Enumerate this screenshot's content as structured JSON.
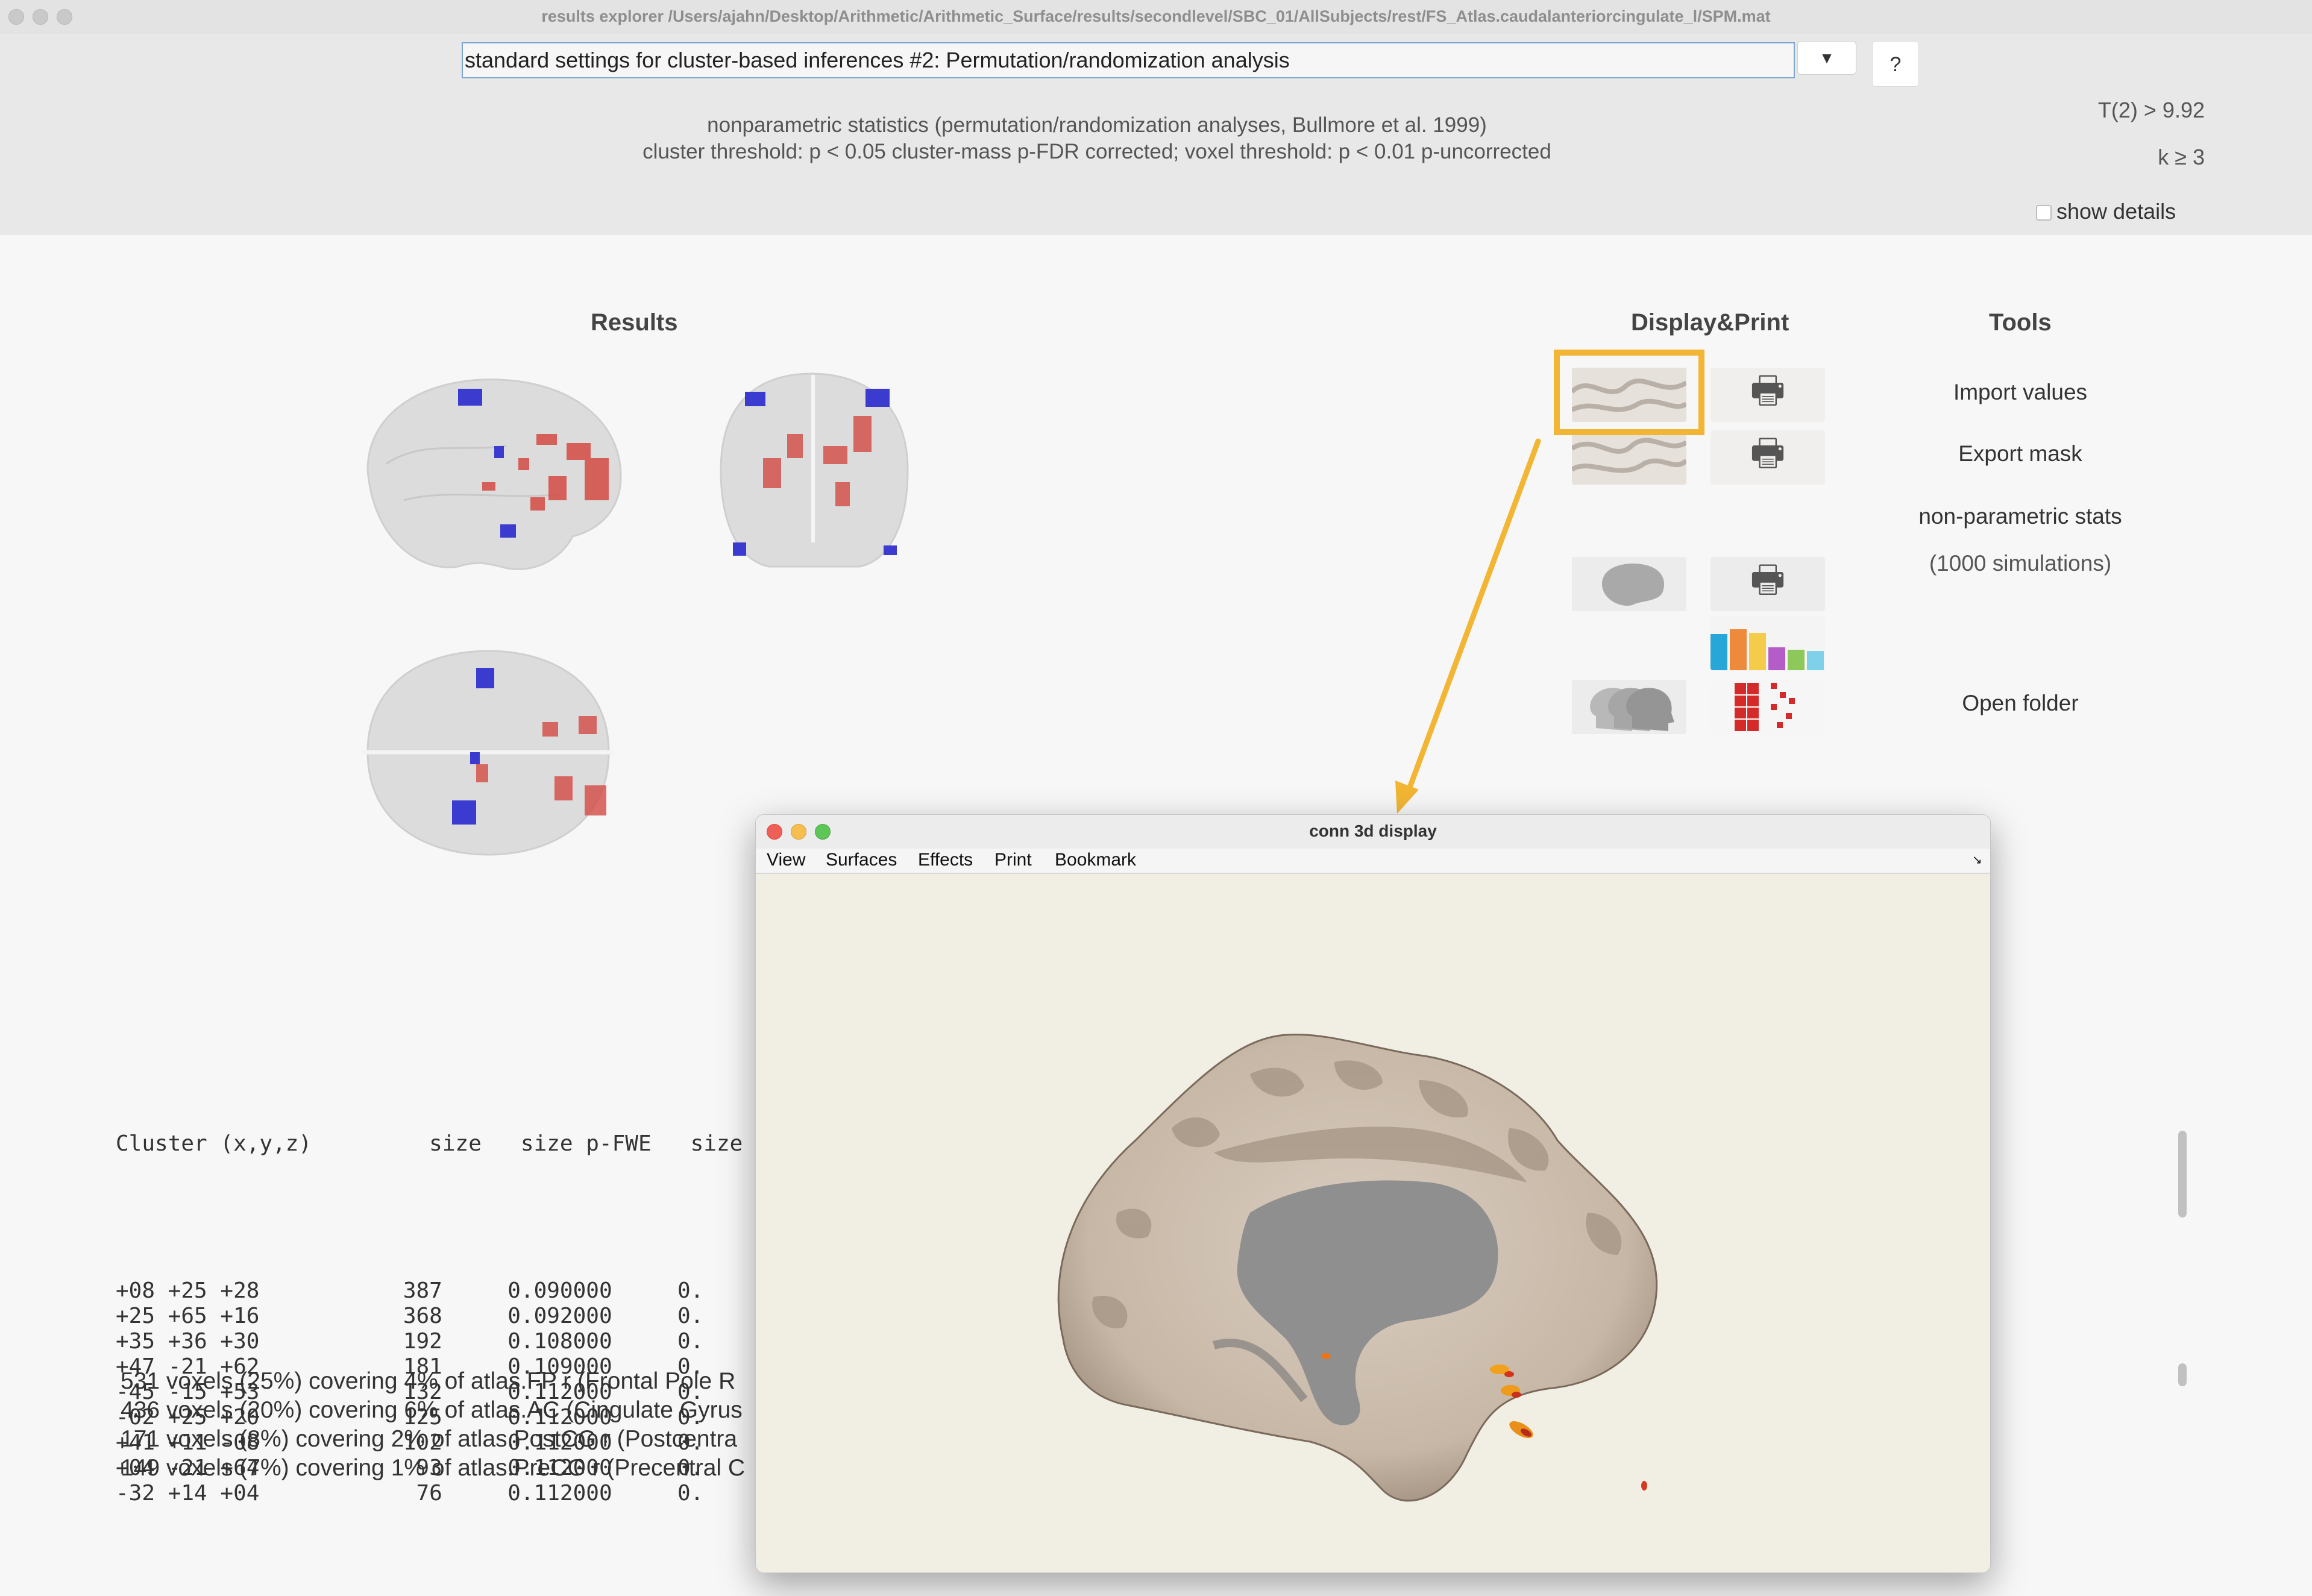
{
  "window": {
    "title": "results explorer /Users/ajahn/Desktop/Arithmetic/Arithmetic_Surface/results/secondlevel/SBC_01/AllSubjects/rest/FS_Atlas.caudalanteriorcingulate_l/SPM.mat"
  },
  "settings": {
    "selected": "standard settings for cluster-based inferences #2: Permutation/randomization analysis",
    "dropdown_glyph": "▼",
    "help_label": "?"
  },
  "description": {
    "line1": "nonparametric statistics (permutation/randomization analyses, Bullmore et al. 1999)",
    "line2": "cluster threshold: p < 0.05 cluster-mass p-FDR corrected; voxel threshold: p < 0.01 p-uncorrected"
  },
  "thresholds": {
    "t": "T(2) > 9.92",
    "k": "k ≥ 3"
  },
  "show_details_label": "show details",
  "results": {
    "title": "Results"
  },
  "display_print": {
    "title": "Display&Print"
  },
  "tools": {
    "title": "Tools",
    "import": "Import values",
    "export": "Export mask",
    "nonparam": "non-parametric stats",
    "sims": "(1000 simulations)",
    "open_folder": "Open folder"
  },
  "table": {
    "header": "Cluster (x,y,z)         size   size p-FWE   size",
    "rows": [
      {
        "coord": "+08 +25 +28",
        "size": "387",
        "pfwe": "0.090000",
        "rest": "0."
      },
      {
        "coord": "+25 +65 +16",
        "size": "368",
        "pfwe": "0.092000",
        "rest": "0."
      },
      {
        "coord": "+35 +36 +30",
        "size": "192",
        "pfwe": "0.108000",
        "rest": "0."
      },
      {
        "coord": "+47 -21 +62",
        "size": "181",
        "pfwe": "0.109000",
        "rest": "0."
      },
      {
        "coord": "-45 -15 +53",
        "size": "132",
        "pfwe": "0.112000",
        "rest": "0."
      },
      {
        "coord": "-02 +25 +20",
        "size": "125",
        "pfwe": "0.112000",
        "rest": "0."
      },
      {
        "coord": "+41 +11 -08",
        "size": "102",
        "pfwe": "0.112000",
        "rest": "0."
      },
      {
        "coord": "+04 -21 +64",
        "size": "93",
        "pfwe": "0.112000",
        "rest": "0."
      },
      {
        "coord": "-32 +14 +04",
        "size": "76",
        "pfwe": "0.112000",
        "rest": "0."
      }
    ]
  },
  "coverage": [
    "531 voxels (25%) covering 4% of atlas.FP r (Frontal Pole R",
    "436 voxels (20%) covering 6% of atlas.AC (Cingulate Gyrus",
    "171 voxels (8%) covering 2% of atlas.PostCG r (Postcentra",
    "149 voxels (7%) covering 1% of atlas.PreCG r (Precentral C"
  ],
  "viewer": {
    "title": "conn 3d display",
    "menu": [
      "View",
      "Surfaces",
      "Effects",
      "Print",
      "Bookmark"
    ],
    "corner_glyph": "↘"
  },
  "icons": {
    "brain_surface": "brain-surface-icon",
    "print": "printer-icon",
    "glass_brain": "glass-brain-icon",
    "bar_chart": "bar-chart-icon",
    "heads": "heads-icon",
    "matrix": "matrix-icon"
  },
  "colors": {
    "highlight": "#f2b634",
    "positive_effect": "#d43a32",
    "negative_effect": "#3a3ad0",
    "viewer_bg": "#f1efe4"
  }
}
